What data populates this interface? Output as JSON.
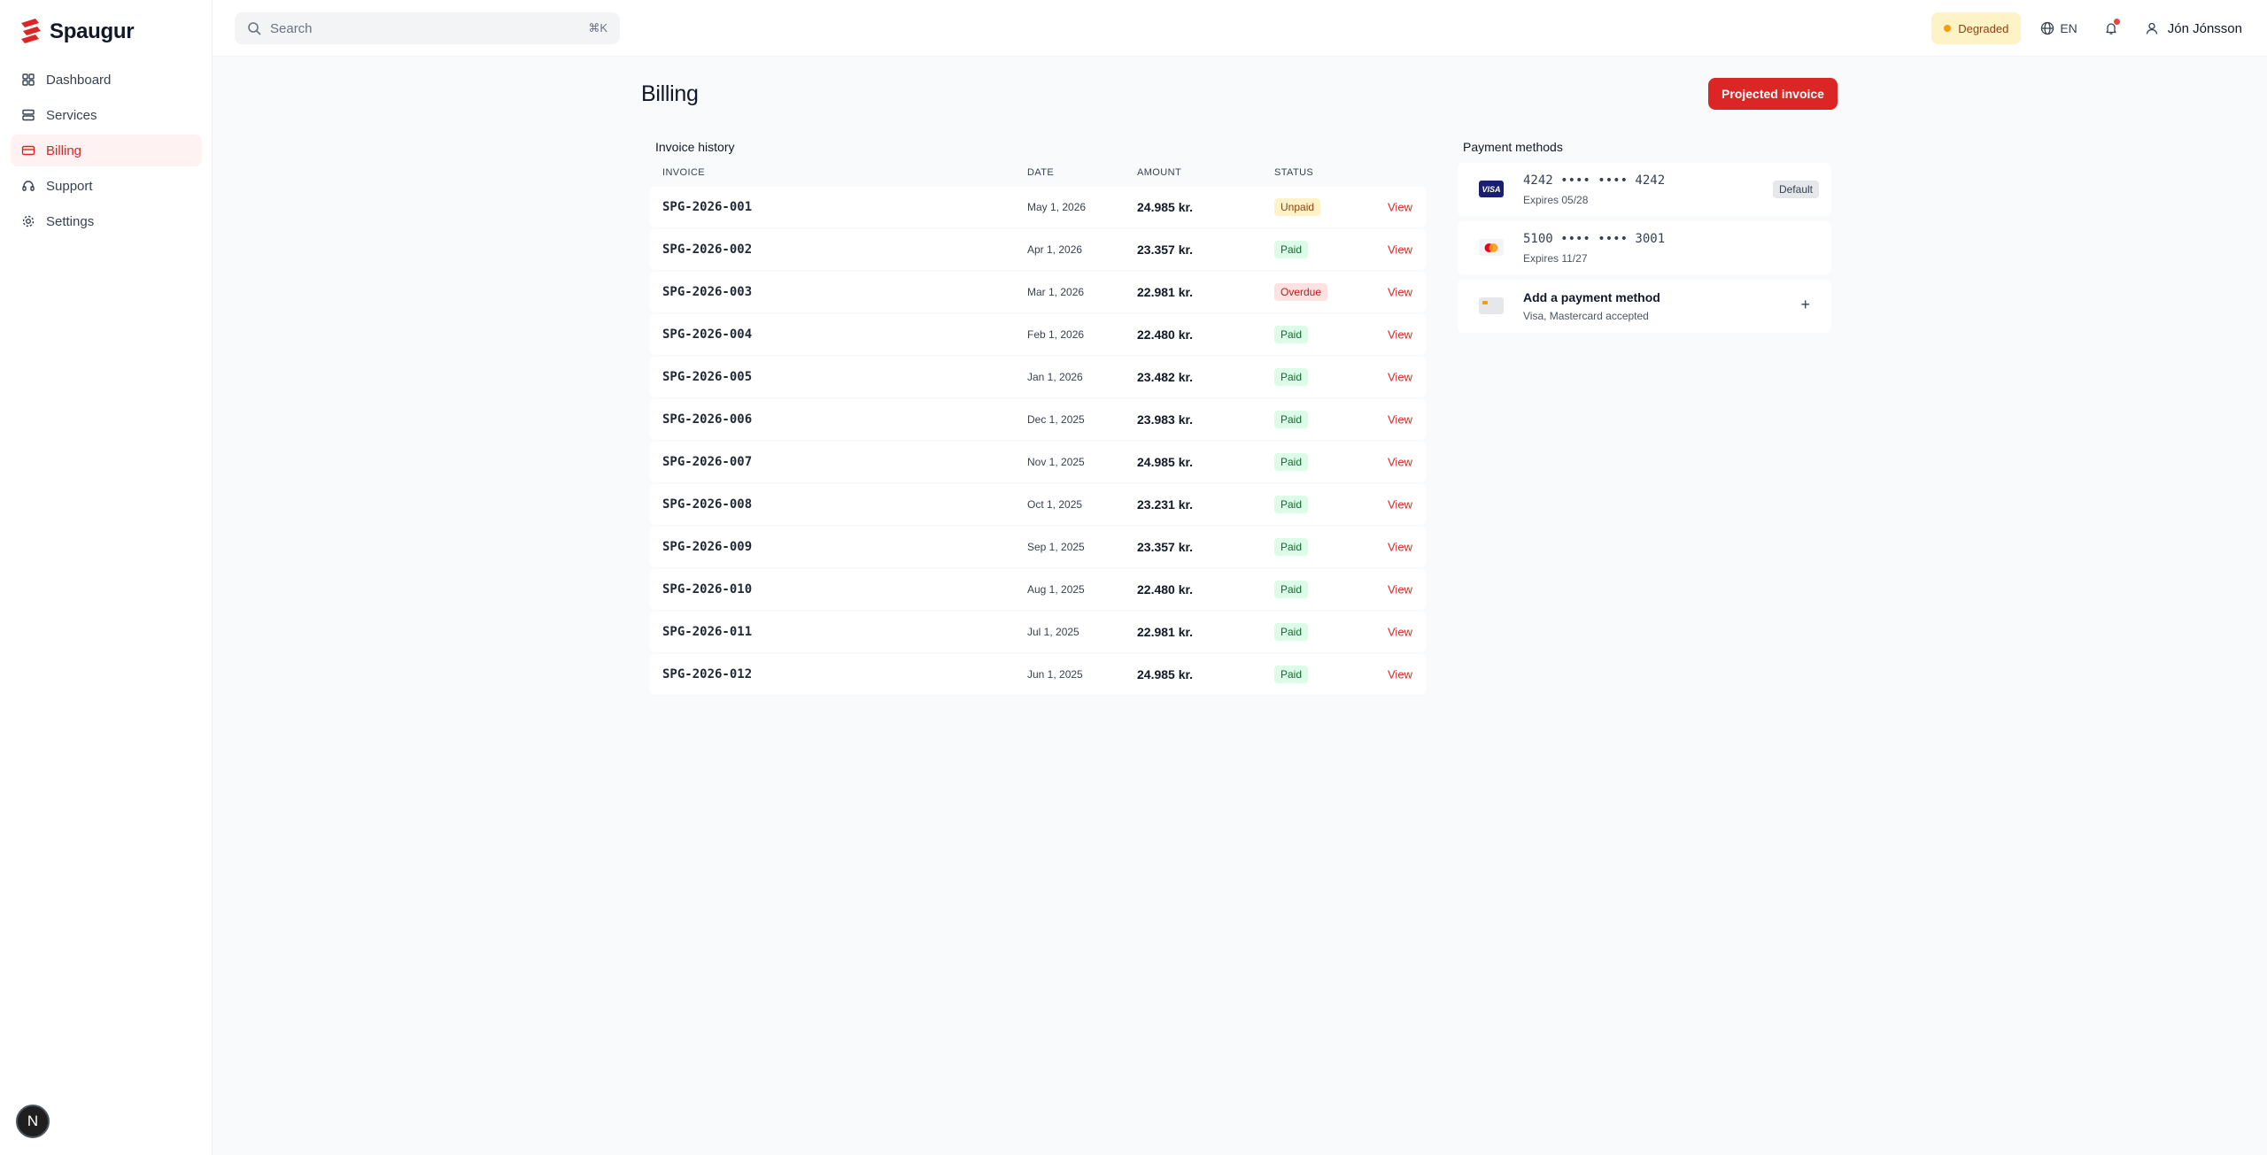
{
  "brand": {
    "name": "Spaugur",
    "accent": "#dc2626"
  },
  "sidebar": {
    "items": [
      {
        "label": "Dashboard",
        "icon": "grid-icon"
      },
      {
        "label": "Services",
        "icon": "server-icon"
      },
      {
        "label": "Billing",
        "icon": "credit-card-icon",
        "active": true
      },
      {
        "label": "Support",
        "icon": "headset-icon"
      },
      {
        "label": "Settings",
        "icon": "gear-icon"
      }
    ],
    "avatar_letter": "N"
  },
  "topbar": {
    "search_placeholder": "Search",
    "search_shortcut": "⌘K",
    "status_label": "Degraded",
    "language": "EN",
    "user_name": "Jón Jónsson"
  },
  "page": {
    "title": "Billing",
    "primary_action": "Projected invoice"
  },
  "invoices": {
    "title": "Invoice history",
    "columns": [
      "INVOICE",
      "DATE",
      "AMOUNT",
      "STATUS"
    ],
    "view_label": "View",
    "rows": [
      {
        "id": "SPG-2026-001",
        "date": "May 1, 2026",
        "amount": "24.985 kr.",
        "status": "Unpaid"
      },
      {
        "id": "SPG-2026-002",
        "date": "Apr 1, 2026",
        "amount": "23.357 kr.",
        "status": "Paid"
      },
      {
        "id": "SPG-2026-003",
        "date": "Mar 1, 2026",
        "amount": "22.981 kr.",
        "status": "Overdue"
      },
      {
        "id": "SPG-2026-004",
        "date": "Feb 1, 2026",
        "amount": "22.480 kr.",
        "status": "Paid"
      },
      {
        "id": "SPG-2026-005",
        "date": "Jan 1, 2026",
        "amount": "23.482 kr.",
        "status": "Paid"
      },
      {
        "id": "SPG-2026-006",
        "date": "Dec 1, 2025",
        "amount": "23.983 kr.",
        "status": "Paid"
      },
      {
        "id": "SPG-2026-007",
        "date": "Nov 1, 2025",
        "amount": "24.985 kr.",
        "status": "Paid"
      },
      {
        "id": "SPG-2026-008",
        "date": "Oct 1, 2025",
        "amount": "23.231 kr.",
        "status": "Paid"
      },
      {
        "id": "SPG-2026-009",
        "date": "Sep 1, 2025",
        "amount": "23.357 kr.",
        "status": "Paid"
      },
      {
        "id": "SPG-2026-010",
        "date": "Aug 1, 2025",
        "amount": "22.480 kr.",
        "status": "Paid"
      },
      {
        "id": "SPG-2026-011",
        "date": "Jul 1, 2025",
        "amount": "22.981 kr.",
        "status": "Paid"
      },
      {
        "id": "SPG-2026-012",
        "date": "Jun 1, 2025",
        "amount": "24.985 kr.",
        "status": "Paid"
      }
    ]
  },
  "payment_methods": {
    "title": "Payment methods",
    "cards": [
      {
        "brand": "visa",
        "brand_label": "VISA",
        "number": "4242 •••• •••• 4242",
        "expires": "Expires 05/28",
        "badge": "Default"
      },
      {
        "brand": "mastercard",
        "number": "5100 •••• •••• 3001",
        "expires": "Expires 11/27",
        "badge": ""
      }
    ],
    "add": {
      "title": "Add a payment method",
      "subtitle": "Visa, Mastercard accepted"
    }
  }
}
